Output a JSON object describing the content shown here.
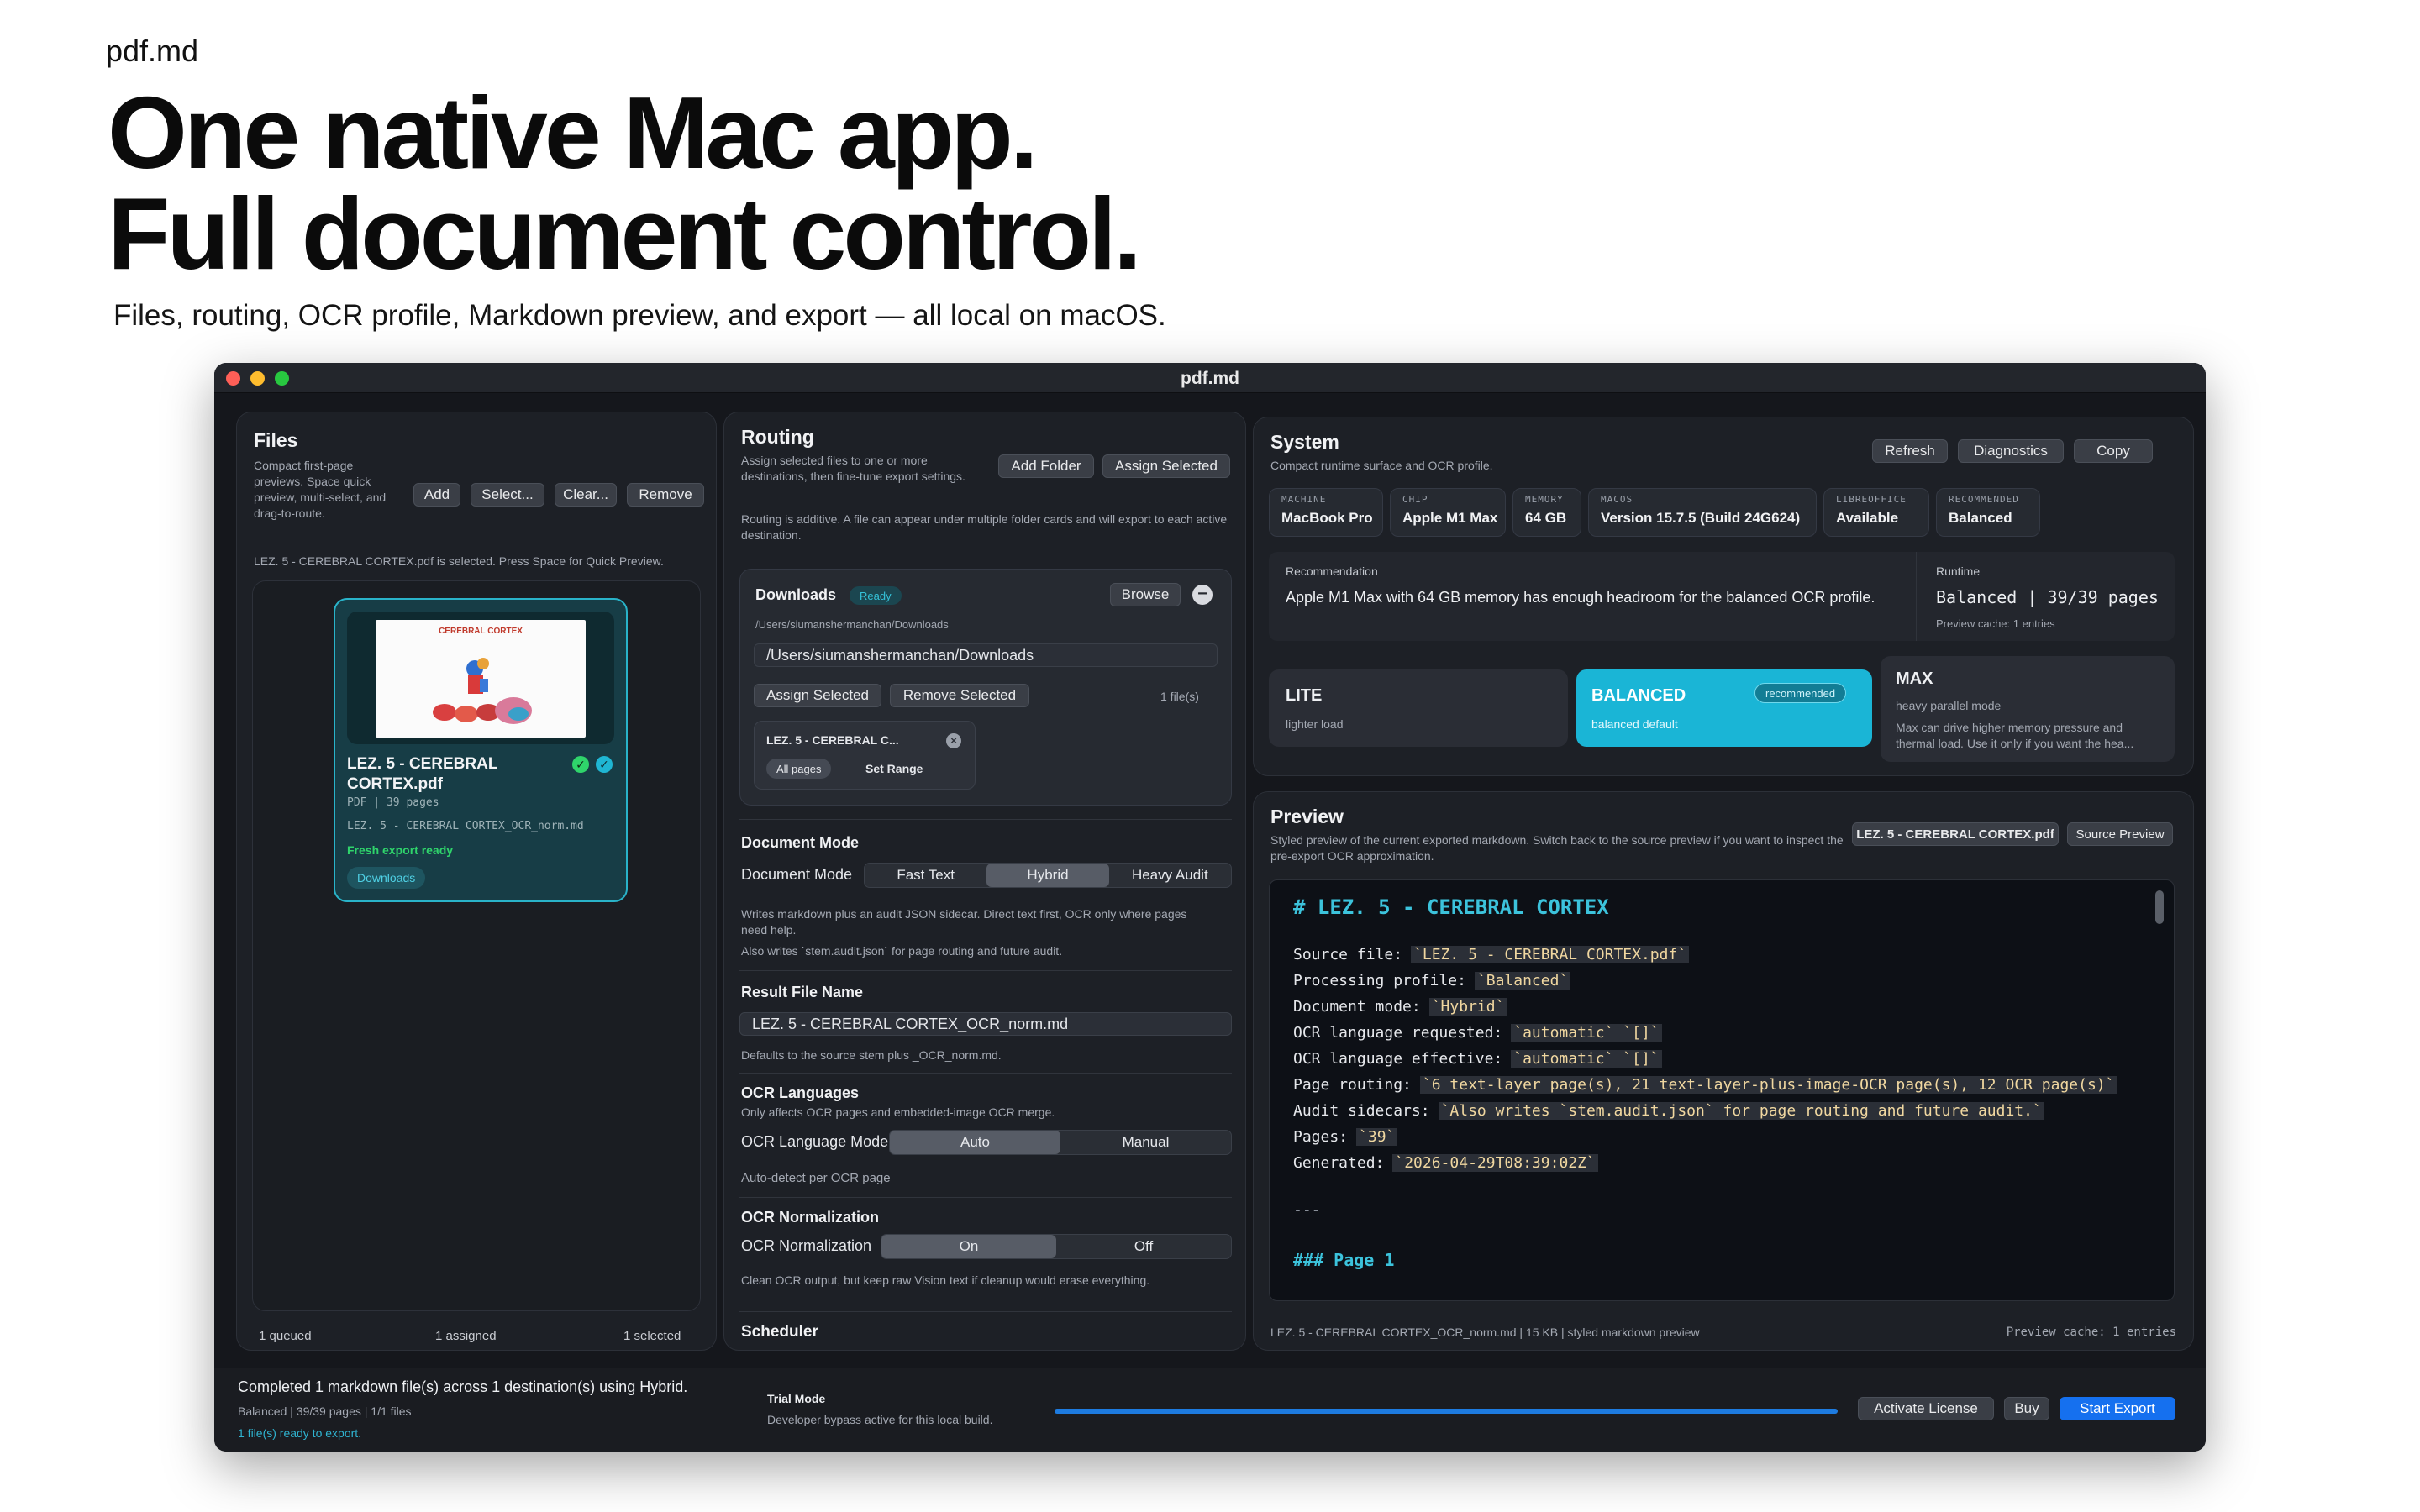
{
  "hero": {
    "brand": "pdf.md",
    "title_line1": "One native Mac app.",
    "title_line2": "Full document control.",
    "subtitle": "Files, routing, OCR profile, Markdown preview, and export — all local on macOS."
  },
  "window": {
    "title": "pdf.md"
  },
  "files": {
    "title": "Files",
    "description": "Compact first-page previews. Space quick preview, multi-select, and drag-to-route.",
    "buttons": {
      "add": "Add",
      "select": "Select...",
      "clear": "Clear...",
      "remove": "Remove"
    },
    "status": "LEZ. 5 - CEREBRAL CORTEX.pdf is selected. Press Space for Quick Preview.",
    "card": {
      "thumb_title": "CEREBRAL CORTEX",
      "name": "LEZ. 5 - CEREBRAL CORTEX.pdf",
      "meta": "PDF  |  39 pages",
      "output": "LEZ. 5 - CEREBRAL CORTEX_OCR_norm.md",
      "state": "Fresh export ready",
      "destination": "Downloads"
    },
    "footer": {
      "queued": "1 queued",
      "assigned": "1 assigned",
      "selected": "1 selected"
    }
  },
  "routing": {
    "title": "Routing",
    "description": "Assign selected files to one or more destinations, then fine-tune export settings.",
    "add_folder": "Add Folder",
    "assign_selected": "Assign Selected",
    "note": "Routing is additive. A file can appear under multiple folder cards and will export to each active destination.",
    "destination": {
      "name": "Downloads",
      "badge": "Ready",
      "browse": "Browse",
      "path_small": "/Users/siumanshermanchan/Downloads",
      "path_field": "/Users/siumanshermanchan/Downloads",
      "assign_selected": "Assign Selected",
      "remove_selected": "Remove Selected",
      "count": "1 file(s)",
      "file_tag": "LEZ. 5 - CEREBRAL C...",
      "all_pages": "All pages",
      "set_range": "Set Range"
    },
    "document_mode": {
      "section": "Document Mode",
      "label": "Document Mode",
      "options": [
        "Fast Text",
        "Hybrid",
        "Heavy Audit"
      ],
      "selected": "Hybrid",
      "help1": "Writes markdown plus an audit JSON sidecar. Direct text first, OCR only where pages need help.",
      "help2": "Also writes `stem.audit.json` for page routing and future audit."
    },
    "result_file": {
      "section": "Result File Name",
      "value": "LEZ. 5 - CEREBRAL CORTEX_OCR_norm.md",
      "help": "Defaults to the source stem plus _OCR_norm.md."
    },
    "ocr_languages": {
      "section": "OCR Languages",
      "help": "Only affects OCR pages and embedded-image OCR merge.",
      "label": "OCR Language Mode",
      "options": [
        "Auto",
        "Manual"
      ],
      "selected": "Auto",
      "note": "Auto-detect per OCR page"
    },
    "ocr_normalization": {
      "section": "OCR Normalization",
      "label": "OCR Normalization",
      "options": [
        "On",
        "Off"
      ],
      "selected": "On",
      "help": "Clean OCR output, but keep raw Vision text if cleanup would erase everything."
    },
    "scheduler": "Scheduler"
  },
  "system": {
    "title": "System",
    "description": "Compact runtime surface and OCR profile.",
    "buttons": {
      "refresh": "Refresh",
      "diagnostics": "Diagnostics",
      "copy": "Copy"
    },
    "chips": [
      {
        "key": "MACHINE",
        "value": "MacBook Pro"
      },
      {
        "key": "CHIP",
        "value": "Apple M1 Max"
      },
      {
        "key": "MEMORY",
        "value": "64 GB"
      },
      {
        "key": "MACOS",
        "value": "Version 15.7.5 (Build 24G624)"
      },
      {
        "key": "LIBREOFFICE",
        "value": "Available"
      },
      {
        "key": "RECOMMENDED",
        "value": "Balanced"
      }
    ],
    "recommendation": {
      "label": "Recommendation",
      "text": "Apple M1 Max with 64 GB memory has enough headroom for the balanced OCR profile."
    },
    "runtime": {
      "label": "Runtime",
      "value": "Balanced | 39/39 pages",
      "cache": "Preview cache: 1 entries"
    },
    "profiles": [
      {
        "name": "LITE",
        "desc": "lighter load"
      },
      {
        "name": "BALANCED",
        "desc": "balanced default",
        "badge": "recommended"
      },
      {
        "name": "MAX",
        "desc": "heavy parallel mode",
        "detail": "Max can drive higher memory pressure and thermal load. Use it only if you want the hea..."
      }
    ]
  },
  "preview": {
    "title": "Preview",
    "description": "Styled preview of the current exported markdown. Switch back to the source preview if you want to inspect the pre-export OCR approximation.",
    "file_button": "LEZ. 5 - CEREBRAL CORTEX.pdf",
    "source_button": "Source Preview",
    "heading": "# LEZ. 5 - CEREBRAL CORTEX",
    "lines": [
      {
        "key": "Source file:",
        "value": "`LEZ. 5 - CEREBRAL CORTEX.pdf`"
      },
      {
        "key": "Processing profile:",
        "value": "`Balanced`"
      },
      {
        "key": "Document mode:",
        "value": "`Hybrid`"
      },
      {
        "key": "OCR language requested:",
        "value": "`automatic` `[]`"
      },
      {
        "key": "OCR language effective:",
        "value": "`automatic` `[]`"
      },
      {
        "key": "Page routing:",
        "value": "`6 text-layer page(s), 21 text-layer-plus-image-OCR page(s), 12 OCR page(s)`"
      },
      {
        "key": "Audit sidecars:",
        "value": "`Also writes `stem.audit.json` for page routing and future audit.`"
      },
      {
        "key": "Pages:",
        "value": "`39`"
      },
      {
        "key": "Generated:",
        "value": "`2026-04-29T08:39:02Z`"
      }
    ],
    "separator": "---",
    "page_heading": "### Page 1",
    "status_left": "LEZ. 5 - CEREBRAL CORTEX_OCR_norm.md | 15 KB | styled markdown preview",
    "status_right": "Preview cache: 1 entries"
  },
  "footer": {
    "line1": "Completed 1 markdown file(s) across 1 destination(s) using Hybrid.",
    "line2": "Balanced | 39/39 pages | 1/1 files",
    "line3": "1 file(s) ready to export.",
    "trial_title": "Trial Mode",
    "trial_sub": "Developer bypass active for this local build.",
    "progress": 1.0,
    "activate": "Activate License",
    "buy": "Buy",
    "start": "Start Export"
  },
  "colors": {
    "accent": "#1fb6d3",
    "ready": "#2fd46b",
    "primary": "#1570ef"
  }
}
